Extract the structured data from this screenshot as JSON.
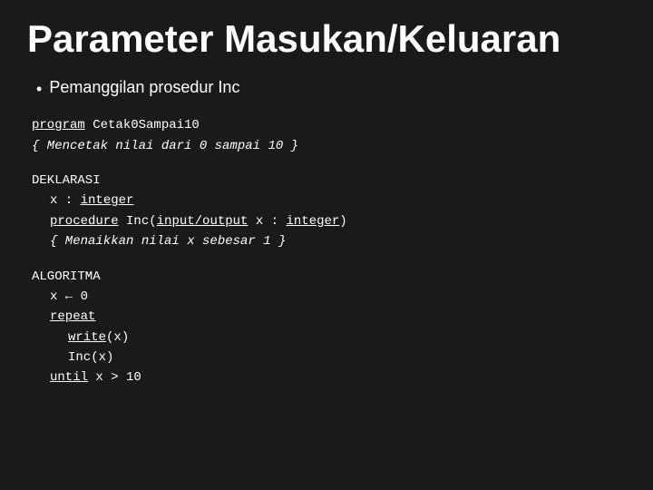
{
  "page": {
    "background": "#1a1a1a",
    "title": "Parameter Masukan/Keluaran",
    "bullet": {
      "text": "Pemanggilan prosedur Inc"
    },
    "program_header": {
      "keyword": "program",
      "name": "Cetak0Sampai10",
      "comment": "{ Mencetak nilai dari 0 sampai 10 }"
    },
    "deklarasi": {
      "label": "DEKLARASI",
      "lines": [
        "x : integer",
        "procedure Inc(input/output x : integer)",
        "{ Menaikkan nilai x sebesar 1 }"
      ]
    },
    "algoritma": {
      "label": "ALGORITMA",
      "lines": [
        "x ← 0",
        "repeat",
        "write(x)",
        "Inc(x)",
        "until x > 10"
      ]
    }
  }
}
